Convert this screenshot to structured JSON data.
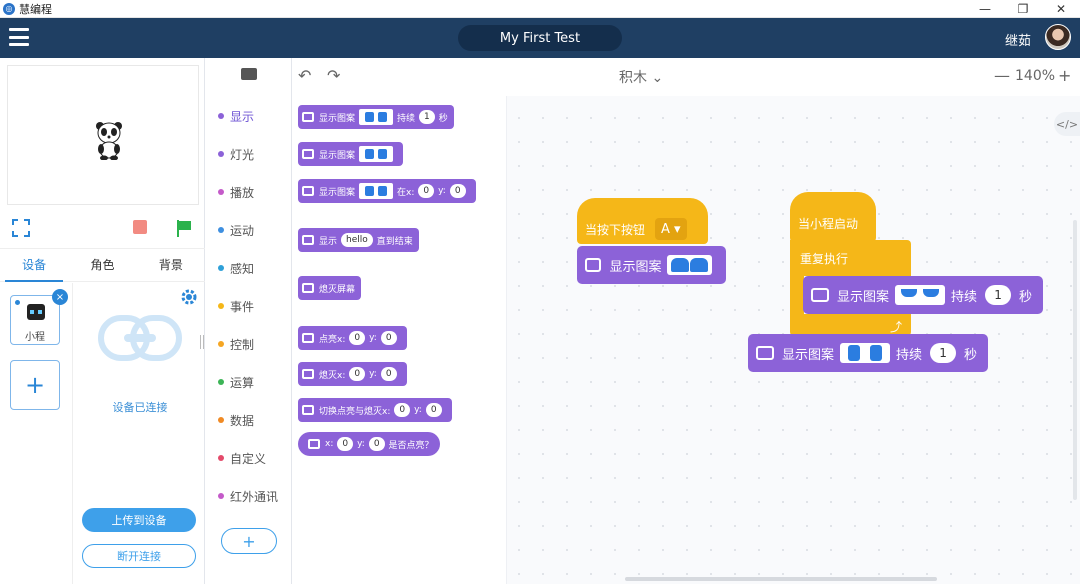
{
  "window": {
    "title": "慧编程",
    "min": "—",
    "max": "❐",
    "close": "✕"
  },
  "header": {
    "project_name": "My First Test",
    "username": "继茹"
  },
  "stage_panel": {
    "tabs": [
      "设备",
      "角色",
      "背景"
    ],
    "device_label": "小程",
    "device_close": "×",
    "add_device": "+",
    "connected_text": "设备已连接",
    "upload_button": "上传到设备",
    "disconnect_button": "断开连接"
  },
  "categories": [
    {
      "label": "显示",
      "color": "#8c62d8"
    },
    {
      "label": "灯光",
      "color": "#8c62d8"
    },
    {
      "label": "播放",
      "color": "#c45ac9"
    },
    {
      "label": "运动",
      "color": "#3e8fe0"
    },
    {
      "label": "感知",
      "color": "#2ea0d8"
    },
    {
      "label": "事件",
      "color": "#f5b718"
    },
    {
      "label": "控制",
      "color": "#f5a623"
    },
    {
      "label": "运算",
      "color": "#3cb456"
    },
    {
      "label": "数据",
      "color": "#f08a24"
    },
    {
      "label": "自定义",
      "color": "#e44a6a"
    },
    {
      "label": "红外通讯",
      "color": "#c45ac9"
    }
  ],
  "category_add": "+",
  "palette": {
    "b1": {
      "text": "显示图案",
      "sustain": "持续",
      "val": "1",
      "unit": "秒"
    },
    "b2": {
      "text": "显示图案"
    },
    "b3": {
      "text": "显示图案",
      "at_x": "在x:",
      "x": "0",
      "y_label": "y:",
      "y": "0"
    },
    "b4": {
      "text": "显示",
      "val": "hello",
      "suffix": "直到结束"
    },
    "b5": {
      "text": "熄灭屏幕"
    },
    "b6": {
      "text": "点亮x:",
      "x": "0",
      "y_label": "y:",
      "y": "0"
    },
    "b7": {
      "text": "熄灭x:",
      "x": "0",
      "y_label": "y:",
      "y": "0"
    },
    "b8": {
      "text": "切换点亮与熄灭x:",
      "x": "0",
      "y_label": "y:",
      "y": "0"
    },
    "b9": {
      "text": "x:",
      "x": "0",
      "y_label": "y:",
      "y": "0",
      "suffix": "是否点亮？"
    }
  },
  "toolbar": {
    "undo": "↶",
    "redo": "↷",
    "mode": "积木 ⌄",
    "zoom_minus": "—",
    "zoom": "140%",
    "zoom_plus": "+",
    "code_toggle": "</>"
  },
  "workspace": {
    "script1": {
      "hat": "当按下按钮",
      "button": "A ▾",
      "block": "显示图案"
    },
    "script2": {
      "hat": "当小程启动",
      "loop": "重复执行",
      "inner_block": "显示图案",
      "inner_sustain": "持续",
      "inner_val": "1",
      "inner_unit": "秒",
      "after_block": "显示图案",
      "after_sustain": "持续",
      "after_val": "1",
      "after_unit": "秒"
    }
  }
}
